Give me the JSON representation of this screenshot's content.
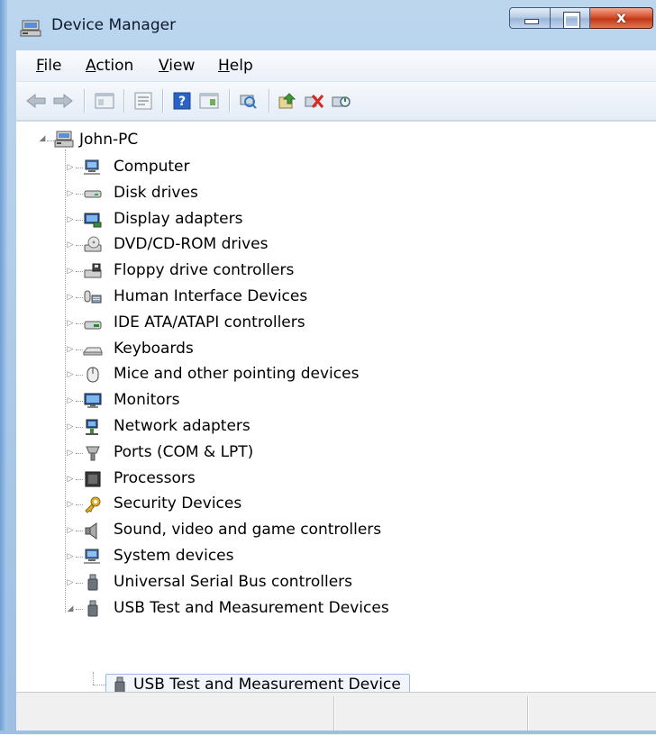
{
  "window": {
    "title": "Device Manager",
    "close_glyph": "x"
  },
  "menu": [
    {
      "label": "File",
      "accel": "F",
      "rest": "ile"
    },
    {
      "label": "Action",
      "accel": "A",
      "rest": "ction"
    },
    {
      "label": "View",
      "accel": "V",
      "rest": "iew"
    },
    {
      "label": "Help",
      "accel": "H",
      "rest": "elp"
    }
  ],
  "toolbar": [
    {
      "name": "back-arrow-icon"
    },
    {
      "name": "forward-arrow-icon"
    },
    {
      "name": "show-hide-console-tree-icon"
    },
    {
      "name": "properties-icon"
    },
    {
      "name": "help-icon",
      "glyph": "?"
    },
    {
      "name": "action-pane-icon"
    },
    {
      "name": "scan-hardware-changes-icon"
    },
    {
      "name": "update-driver-icon"
    },
    {
      "name": "uninstall-device-icon"
    },
    {
      "name": "disable-device-icon"
    }
  ],
  "tree": {
    "root": {
      "label": "John-PC",
      "icon": "computer-root-icon"
    },
    "categories": [
      {
        "label": "Computer",
        "icon": "computer-icon"
      },
      {
        "label": "Disk drives",
        "icon": "disk-drive-icon"
      },
      {
        "label": "Display adapters",
        "icon": "display-adapter-icon"
      },
      {
        "label": "DVD/CD-ROM drives",
        "icon": "dvd-drive-icon"
      },
      {
        "label": "Floppy drive controllers",
        "icon": "floppy-controller-icon"
      },
      {
        "label": "Human Interface Devices",
        "icon": "hid-icon"
      },
      {
        "label": "IDE ATA/ATAPI controllers",
        "icon": "ide-controller-icon"
      },
      {
        "label": "Keyboards",
        "icon": "keyboard-icon"
      },
      {
        "label": "Mice and other pointing devices",
        "icon": "mouse-icon"
      },
      {
        "label": "Monitors",
        "icon": "monitor-icon"
      },
      {
        "label": "Network adapters",
        "icon": "network-adapter-icon"
      },
      {
        "label": "Ports (COM & LPT)",
        "icon": "port-icon"
      },
      {
        "label": "Processors",
        "icon": "processor-icon"
      },
      {
        "label": "Security Devices",
        "icon": "security-key-icon"
      },
      {
        "label": "Sound, video and game controllers",
        "icon": "speaker-icon"
      },
      {
        "label": "System devices",
        "icon": "system-device-icon"
      },
      {
        "label": "Universal Serial Bus controllers",
        "icon": "usb-plug-icon"
      },
      {
        "label": "USB Test and Measurement Devices",
        "icon": "usb-plug-icon",
        "expanded": true
      }
    ],
    "child": {
      "label": "USB Test and Measurement Device",
      "icon": "usb-plug-icon",
      "selected": true
    }
  }
}
